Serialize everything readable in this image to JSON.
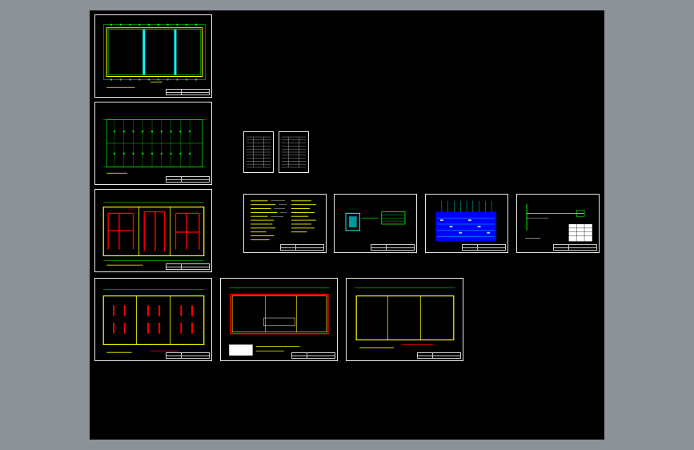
{
  "app": {
    "view": "cad-drawing-viewport",
    "background_color": "#8d9298",
    "canvas_color": "#000000"
  },
  "colors": {
    "grid": "#00ff00",
    "wall": "#ffff00",
    "cyan": "#00ffff",
    "red": "#ff0000",
    "frame": "#ffffff",
    "blue_panel": "#0000ff"
  },
  "sheets": [
    {
      "id": "plan-1",
      "kind": "floor-plan",
      "variant": "cyan-columns"
    },
    {
      "id": "plan-2",
      "kind": "floor-plan",
      "variant": "grid-dots"
    },
    {
      "id": "plan-3",
      "kind": "floor-plan",
      "variant": "red-equipment"
    },
    {
      "id": "plan-4",
      "kind": "floor-plan",
      "variant": "red-small"
    },
    {
      "id": "plan-5",
      "kind": "floor-plan",
      "variant": "red-outline"
    },
    {
      "id": "plan-6",
      "kind": "floor-plan",
      "variant": "yellow-outline"
    },
    {
      "id": "table-1",
      "kind": "schedule-table"
    },
    {
      "id": "table-2",
      "kind": "schedule-table"
    },
    {
      "id": "notes-1",
      "kind": "design-notes"
    },
    {
      "id": "legend-1",
      "kind": "legend"
    },
    {
      "id": "system-1",
      "kind": "system-diagram"
    },
    {
      "id": "detail-1",
      "kind": "detail-drawing"
    }
  ]
}
